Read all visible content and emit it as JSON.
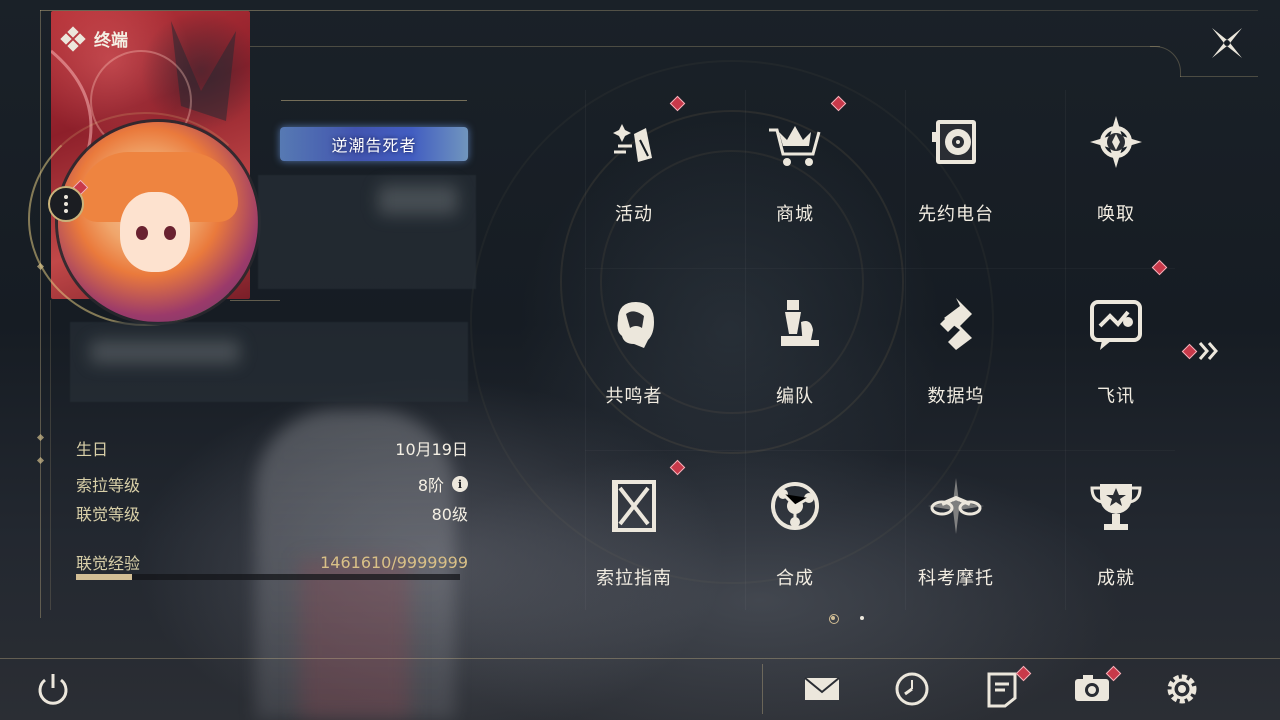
{
  "header": {
    "terminal_label": "终端"
  },
  "profile": {
    "title_badge": "逆潮告死者",
    "stats": [
      {
        "label": "生日",
        "value": "10月19日"
      },
      {
        "label": "索拉等级",
        "value": "8阶"
      },
      {
        "label": "联觉等级",
        "value": "80级"
      }
    ],
    "exp": {
      "label": "联觉经验",
      "value": "1461610/9999999",
      "fraction": 0.146
    }
  },
  "menu": [
    {
      "label": "活动",
      "icon": "activity-icon",
      "badge": true
    },
    {
      "label": "商城",
      "icon": "shop-cart-icon",
      "badge": true
    },
    {
      "label": "先约电台",
      "icon": "radio-icon",
      "badge": false
    },
    {
      "label": "唤取",
      "icon": "summon-compass-icon",
      "badge": false
    },
    {
      "label": "共鸣者",
      "icon": "resonator-head-icon",
      "badge": false
    },
    {
      "label": "编队",
      "icon": "team-chess-icon",
      "badge": false
    },
    {
      "label": "数据坞",
      "icon": "data-bank-icon",
      "badge": false
    },
    {
      "label": "飞讯",
      "icon": "message-icon",
      "badge": true
    },
    {
      "label": "索拉指南",
      "icon": "guide-book-icon",
      "badge": true
    },
    {
      "label": "合成",
      "icon": "synthesis-icon",
      "badge": false
    },
    {
      "label": "科考摩托",
      "icon": "motorcycle-icon",
      "badge": false
    },
    {
      "label": "成就",
      "icon": "achievement-trophy-icon",
      "badge": false
    }
  ],
  "pagination": {
    "current": 1,
    "total": 2
  },
  "bottom_bar": [
    {
      "name": "mail-icon",
      "badge": false
    },
    {
      "name": "clock-icon",
      "badge": false
    },
    {
      "name": "notice-icon",
      "badge": true
    },
    {
      "name": "camera-icon",
      "badge": true
    },
    {
      "name": "settings-gear-icon",
      "badge": false
    }
  ],
  "colors": {
    "accent_gold": "#d2be95",
    "badge_red": "#c8394a",
    "text_light": "#f1ece1"
  }
}
